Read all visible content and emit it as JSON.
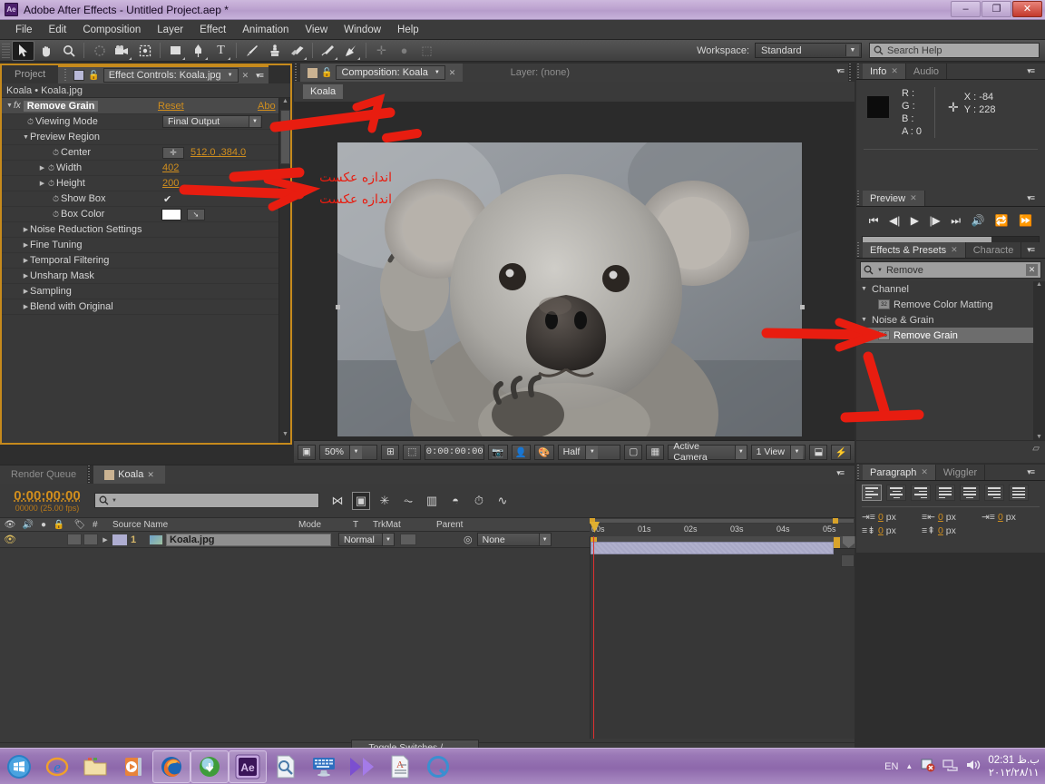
{
  "window": {
    "title": "Adobe After Effects - Untitled Project.aep *",
    "app_badge": "Ae",
    "minimize": "–",
    "maximize": "❐",
    "close": "✕"
  },
  "menu": {
    "items": [
      "File",
      "Edit",
      "Composition",
      "Layer",
      "Effect",
      "Animation",
      "View",
      "Window",
      "Help"
    ]
  },
  "toolbar": {
    "tools": [
      {
        "name": "selection-tool",
        "glyph": "➤"
      },
      {
        "name": "hand-tool",
        "glyph": "✋"
      },
      {
        "name": "zoom-tool",
        "glyph": "🔍"
      },
      {
        "name": "rotation-tool",
        "glyph": "↻"
      },
      {
        "name": "camera-tool",
        "glyph": "🎥"
      },
      {
        "name": "pan-behind-tool",
        "glyph": "⛶"
      },
      {
        "name": "shape-tool",
        "glyph": "▢"
      },
      {
        "name": "pen-tool",
        "glyph": "✒"
      },
      {
        "name": "text-tool",
        "glyph": "T"
      },
      {
        "name": "brush-tool",
        "glyph": "🖌"
      },
      {
        "name": "clone-stamp-tool",
        "glyph": "⚱"
      },
      {
        "name": "eraser-tool",
        "glyph": "▱"
      },
      {
        "name": "roto-brush-tool",
        "glyph": "🖍"
      },
      {
        "name": "puppet-pin-tool",
        "glyph": "📌"
      }
    ],
    "workspace_label": "Workspace:",
    "workspace_value": "Standard",
    "search_help_placeholder": "Search Help"
  },
  "effect_controls": {
    "tab_project": "Project",
    "tab_active": "Effect Controls: Koala.jpg",
    "breadcrumb": "Koala • Koala.jpg",
    "effect_name": "Remove Grain",
    "reset_label": "Reset",
    "about_label": "Abo",
    "properties": [
      {
        "name": "Viewing Mode",
        "type": "dropdown",
        "value": "Final Output",
        "indent": 1
      },
      {
        "name": "Preview Region",
        "type": "group-open",
        "value": "",
        "indent": 1
      },
      {
        "name": "Center",
        "type": "point",
        "value": "512.0 ,384.0",
        "indent": 2
      },
      {
        "name": "Width",
        "type": "number",
        "value": "402",
        "indent": 2
      },
      {
        "name": "Height",
        "type": "number",
        "value": "200",
        "indent": 2
      },
      {
        "name": "Show Box",
        "type": "checkbox",
        "value": "✔",
        "indent": 2
      },
      {
        "name": "Box Color",
        "type": "color",
        "value": "#ffffff",
        "indent": 2
      },
      {
        "name": "Noise Reduction Settings",
        "type": "group-closed",
        "value": "",
        "indent": 1
      },
      {
        "name": "Fine Tuning",
        "type": "group-closed",
        "value": "",
        "indent": 1
      },
      {
        "name": "Temporal Filtering",
        "type": "group-closed",
        "value": "",
        "indent": 1
      },
      {
        "name": "Unsharp Mask",
        "type": "group-closed",
        "value": "",
        "indent": 1
      },
      {
        "name": "Sampling",
        "type": "group-closed",
        "value": "",
        "indent": 1
      },
      {
        "name": "Blend with Original",
        "type": "group-closed",
        "value": "",
        "indent": 1
      }
    ]
  },
  "composition": {
    "tab_active": "Composition: Koala",
    "tab_layer": "Layer: (none)",
    "breadcrumb_chip": "Koala",
    "bottom_bar": {
      "zoom": "50%",
      "time": "0:00:00:00",
      "resolution": "Half",
      "camera": "Active Camera",
      "views": "1 View"
    }
  },
  "info": {
    "tab": "Info",
    "tab_audio": "Audio",
    "r_label": "R :",
    "r_value": "",
    "g_label": "G :",
    "g_value": "",
    "b_label": "B :",
    "b_value": "",
    "a_label": "A :",
    "a_value": "0",
    "x_label": "X :",
    "x_value": "-84",
    "y_label": "Y :",
    "y_value": "228"
  },
  "preview": {
    "tab": "Preview",
    "buttons": [
      "first-frame",
      "prev-frame",
      "play",
      "next-frame",
      "last-frame",
      "audio",
      "loop",
      "ram-preview"
    ]
  },
  "effects_presets": {
    "tab": "Effects & Presets",
    "tab_character": "Characte",
    "search_value": "Remove",
    "groups": [
      {
        "label": "Channel",
        "open": true,
        "items": [
          {
            "label": "Remove Color Matting",
            "bits": "32",
            "selected": false
          }
        ]
      },
      {
        "label": "Noise & Grain",
        "open": true,
        "items": [
          {
            "label": "Remove Grain",
            "bits": "16",
            "selected": true
          }
        ]
      }
    ]
  },
  "paragraph": {
    "tab": "Paragraph",
    "tab_wiggler": "Wiggler",
    "align_buttons": [
      "align-left",
      "align-center",
      "align-right",
      "justify-last-left",
      "justify-last-center",
      "justify-last-right",
      "justify-all"
    ],
    "fields": [
      {
        "name": "indent-left",
        "value": "0",
        "unit": "px"
      },
      {
        "name": "indent-right",
        "value": "0",
        "unit": "px"
      },
      {
        "name": "indent-first-line",
        "value": "0",
        "unit": "px"
      },
      {
        "name": "space-before",
        "value": "0",
        "unit": "px"
      },
      {
        "name": "space-after",
        "value": "0",
        "unit": "px"
      }
    ]
  },
  "timeline": {
    "tab_render_queue": "Render Queue",
    "tab_active": "Koala",
    "current_time": "0:00:00:00",
    "frame_info": "00000 (25.00 fps)",
    "search_placeholder": "",
    "columns": [
      "#",
      "Source Name",
      "Mode",
      "T",
      "TrkMat",
      "Parent"
    ],
    "layers": [
      {
        "index": "1",
        "source_name": "Koala.jpg",
        "mode": "Normal",
        "trkmat": "",
        "parent": "None"
      }
    ],
    "ruler_ticks": [
      "00s",
      "01s",
      "02s",
      "03s",
      "04s",
      "05s"
    ],
    "toggle_switches_label": "Toggle Switches / Modes"
  },
  "annotations": {
    "persian_1": "اندازه عکست",
    "persian_2": "اندازه عکست"
  },
  "taskbar": {
    "items": [
      {
        "name": "start-button",
        "glyph": "⊞"
      },
      {
        "name": "internet-explorer-icon",
        "glyph": "e"
      },
      {
        "name": "file-explorer-icon",
        "glyph": "📁"
      },
      {
        "name": "media-player-icon",
        "glyph": "▶"
      },
      {
        "name": "firefox-icon",
        "glyph": "🦊"
      },
      {
        "name": "download-manager-icon",
        "glyph": "⬇"
      },
      {
        "name": "after-effects-icon",
        "glyph": "Ae"
      },
      {
        "name": "search-document-icon",
        "glyph": "🔎"
      },
      {
        "name": "keyboard-icon",
        "glyph": "⌨"
      },
      {
        "name": "media-app-icon",
        "glyph": "▷"
      },
      {
        "name": "text-document-icon",
        "glyph": "📄"
      },
      {
        "name": "quicktime-icon",
        "glyph": "Q"
      }
    ],
    "language": "EN",
    "time": "02:31 ب.ظ",
    "date": "۲۰۱۲/۲۸/۱۱"
  },
  "colors": {
    "accent_orange": "#d08e1e",
    "panel_bg": "#3a3a3a",
    "annotation_red": "#e81d10",
    "titlebar": "#bda3d0"
  }
}
